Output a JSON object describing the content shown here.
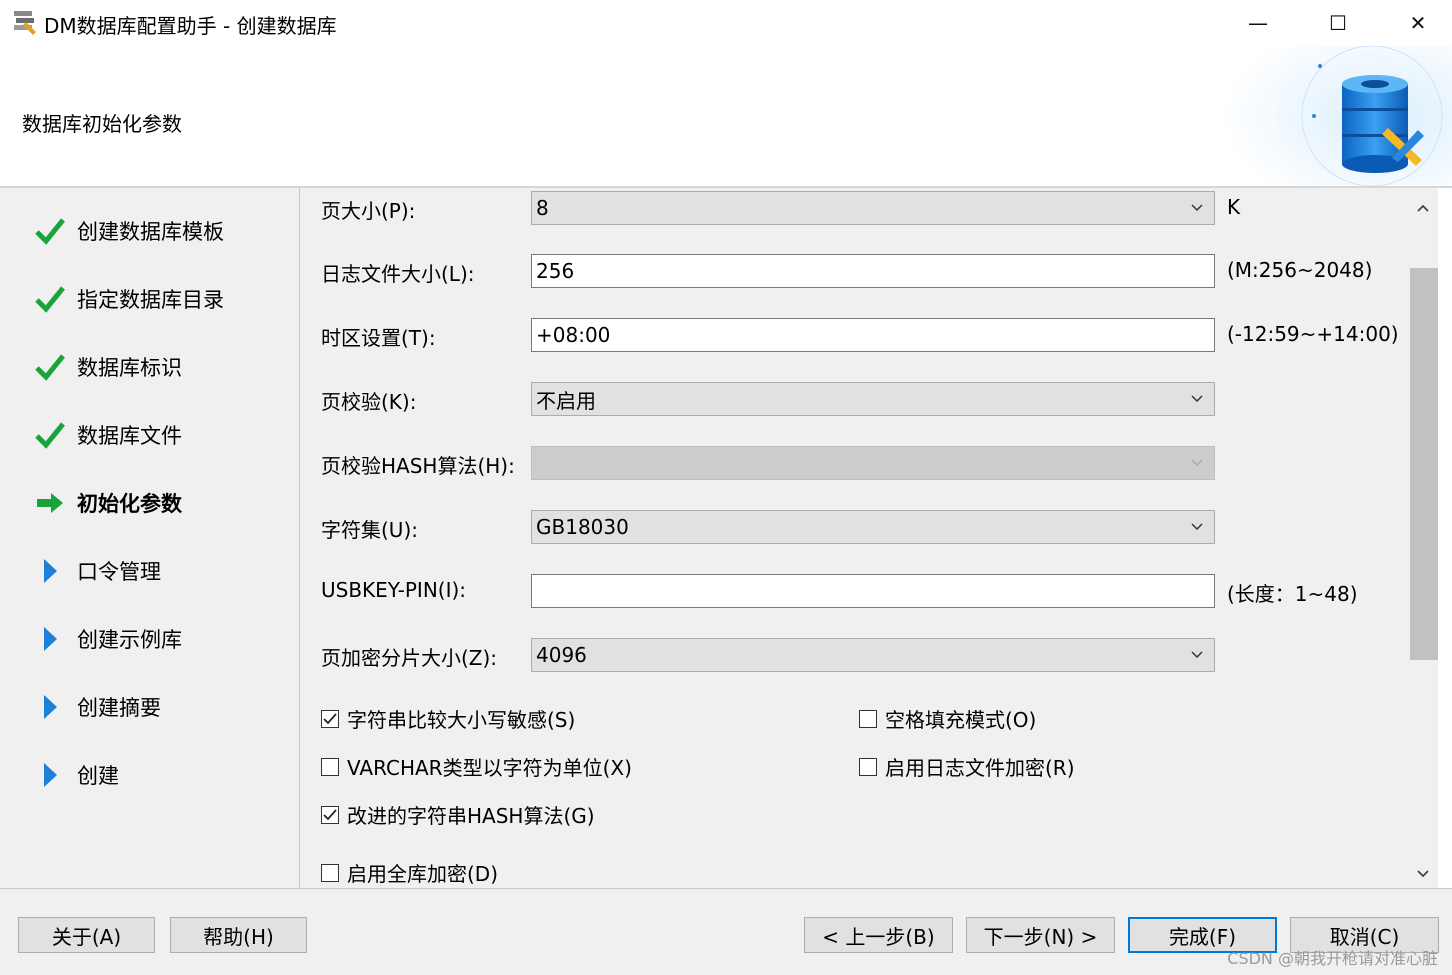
{
  "window": {
    "title": "DM数据库配置助手 - 创建数据库",
    "controls": {
      "minimize": "—",
      "maximize": "☐",
      "close": "✕"
    }
  },
  "header": {
    "title": "数据库初始化参数"
  },
  "sidebar": {
    "steps": [
      {
        "label": "创建数据库模板",
        "state": "done"
      },
      {
        "label": "指定数据库目录",
        "state": "done"
      },
      {
        "label": "数据库标识",
        "state": "done"
      },
      {
        "label": "数据库文件",
        "state": "done"
      },
      {
        "label": "初始化参数",
        "state": "current"
      },
      {
        "label": "口令管理",
        "state": "pending"
      },
      {
        "label": "创建示例库",
        "state": "pending"
      },
      {
        "label": "创建摘要",
        "state": "pending"
      },
      {
        "label": "创建",
        "state": "pending"
      }
    ]
  },
  "form": {
    "page_size": {
      "label": "页大小(P):",
      "value": "8",
      "hint": "K"
    },
    "log_size": {
      "label": "日志文件大小(L):",
      "value": "256",
      "hint": "(M:256~2048)"
    },
    "timezone": {
      "label": "时区设置(T):",
      "value": "+08:00",
      "hint": "(-12:59~+14:00)"
    },
    "page_check": {
      "label": "页校验(K):",
      "value": "不启用"
    },
    "page_check_hash": {
      "label": "页校验HASH算法(H):",
      "value": ""
    },
    "charset": {
      "label": "字符集(U):",
      "value": "GB18030"
    },
    "usbkey_pin": {
      "label": "USBKEY-PIN(I):",
      "value": "",
      "hint": "(长度：1~48)"
    },
    "page_enc_slice": {
      "label": "页加密分片大小(Z):",
      "value": "4096"
    }
  },
  "checkboxes": {
    "case_sensitive": {
      "label": "字符串比较大小写敏感(S)",
      "checked": true
    },
    "blank_pad": {
      "label": "空格填充模式(O)",
      "checked": false
    },
    "varchar_char": {
      "label": "VARCHAR类型以字符为单位(X)",
      "checked": false
    },
    "log_encrypt": {
      "label": "启用日志文件加密(R)",
      "checked": false
    },
    "improved_hash": {
      "label": "改进的字符串HASH算法(G)",
      "checked": true
    },
    "full_encrypt": {
      "label": "启用全库加密(D)",
      "checked": false
    }
  },
  "buttons": {
    "about": "关于(A)",
    "help": "帮助(H)",
    "prev": "< 上一步(B)",
    "next": "下一步(N) >",
    "finish": "完成(F)",
    "cancel": "取消(C)"
  },
  "watermark": "CSDN @朝我开枪请对准心脏",
  "colors": {
    "done": "#1aa33a",
    "current": "#1aa33a",
    "pending": "#1e7fd6",
    "accent": "#0078d7"
  }
}
